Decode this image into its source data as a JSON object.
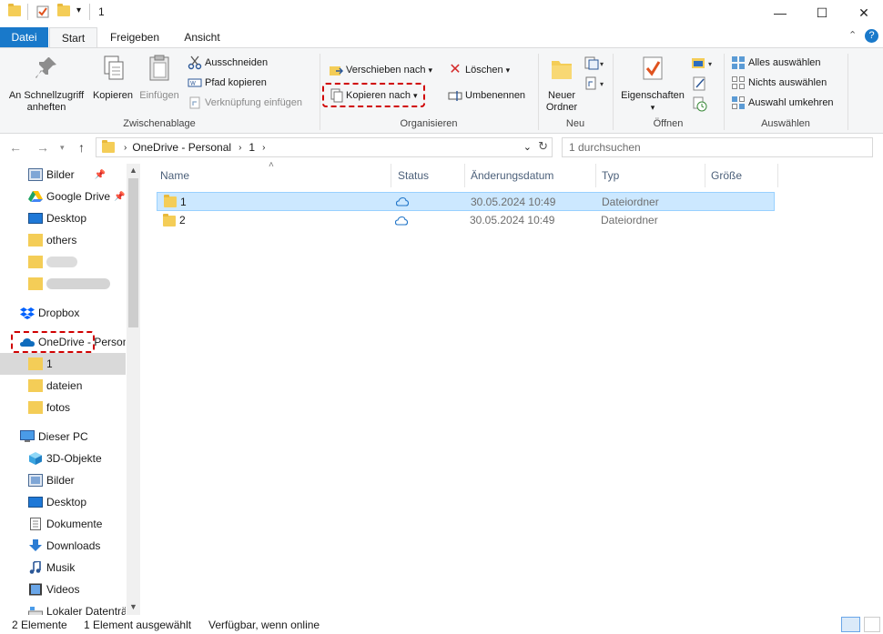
{
  "window": {
    "title": "1",
    "controls": {
      "minimize": "—",
      "maximize": "☐",
      "close": "✕"
    }
  },
  "ribbon_tabs": [
    {
      "label": "Datei"
    },
    {
      "label": "Start"
    },
    {
      "label": "Freigeben"
    },
    {
      "label": "Ansicht"
    }
  ],
  "ribbon": {
    "clipboard": {
      "pin": "An Schnellzugriff anheften",
      "copy": "Kopieren",
      "paste": "Einfügen",
      "cut": "Ausschneiden",
      "copy_path": "Pfad kopieren",
      "paste_shortcut": "Verknüpfung einfügen",
      "label": "Zwischenablage"
    },
    "organize": {
      "move_to": "Verschieben nach",
      "copy_to": "Kopieren nach",
      "delete": "Löschen",
      "rename": "Umbenennen",
      "label": "Organisieren"
    },
    "new": {
      "new_folder": "Neuer Ordner",
      "label": "Neu"
    },
    "open": {
      "properties": "Eigenschaften",
      "label": "Öffnen"
    },
    "select": {
      "select_all": "Alles auswählen",
      "select_none": "Nichts auswählen",
      "invert": "Auswahl umkehren",
      "label": "Auswählen"
    }
  },
  "address": {
    "path": [
      "OneDrive - Personal",
      "1"
    ],
    "search_placeholder": "1 durchsuchen"
  },
  "sidebar": {
    "items": [
      {
        "label": "Bilder",
        "icon": "pictures-icon"
      },
      {
        "label": "Google Drive",
        "icon": "google-drive-icon"
      },
      {
        "label": "Desktop",
        "icon": "desktop-icon"
      },
      {
        "label": "others",
        "icon": "folder-icon"
      },
      {
        "label": "Dropbox",
        "icon": "dropbox-icon"
      },
      {
        "label": "OneDrive - Personal",
        "icon": "onedrive-icon"
      },
      {
        "label": "1",
        "icon": "folder-icon"
      },
      {
        "label": "dateien",
        "icon": "folder-icon"
      },
      {
        "label": "fotos",
        "icon": "folder-icon"
      },
      {
        "label": "Dieser PC",
        "icon": "computer-icon"
      },
      {
        "label": "3D-Objekte",
        "icon": "cube-icon"
      },
      {
        "label": "Bilder",
        "icon": "pictures-icon"
      },
      {
        "label": "Desktop",
        "icon": "desktop-icon"
      },
      {
        "label": "Dokumente",
        "icon": "documents-icon"
      },
      {
        "label": "Downloads",
        "icon": "download-icon"
      },
      {
        "label": "Musik",
        "icon": "music-icon"
      },
      {
        "label": "Videos",
        "icon": "video-icon"
      },
      {
        "label": "Lokaler Datenträger",
        "icon": "drive-icon"
      }
    ]
  },
  "filelist": {
    "columns": [
      "Name",
      "Status",
      "Änderungsdatum",
      "Typ",
      "Größe"
    ],
    "rows": [
      {
        "name": "1",
        "date": "30.05.2024 10:49",
        "type": "Dateiordner",
        "size": ""
      },
      {
        "name": "2",
        "date": "30.05.2024 10:49",
        "type": "Dateiordner",
        "size": ""
      }
    ]
  },
  "status": {
    "count": "2 Elemente",
    "selected": "1 Element ausgewählt",
    "availability": "Verfügbar, wenn online"
  },
  "colors": {
    "accent": "#1979ca",
    "selection": "#cce8ff",
    "highlight_box": "#d00000",
    "folder": "#f4cd57"
  }
}
